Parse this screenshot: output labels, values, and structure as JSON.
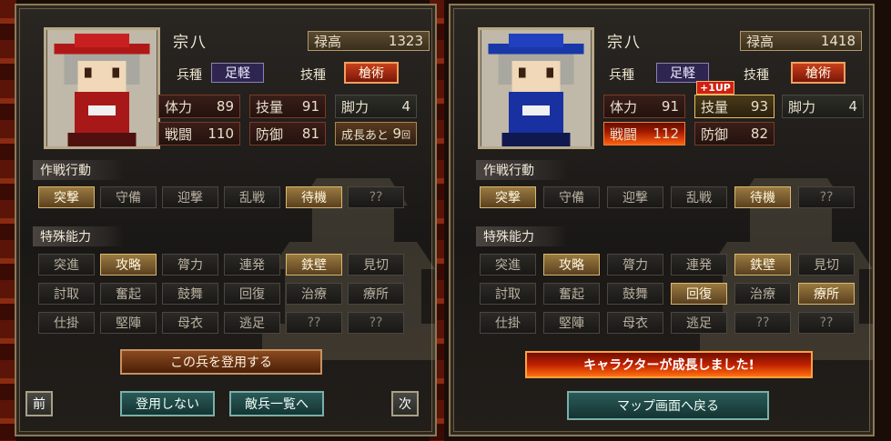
{
  "colors": {
    "accent": "#c8401a",
    "selected": "#9a7a40",
    "teal": "#2a5a58"
  },
  "left": {
    "name": "宗八",
    "rokudaka_label": "禄高",
    "rokudaka_value": "1323",
    "heishu_label": "兵種",
    "heishu_value": "足軽",
    "gijutsu_label": "技種",
    "gijutsu_value": "槍術",
    "stats": [
      {
        "label": "体力",
        "value": "89"
      },
      {
        "label": "技量",
        "value": "91"
      },
      {
        "label": "脚力",
        "value": "4"
      },
      {
        "label": "戦闘",
        "value": "110"
      },
      {
        "label": "防御",
        "value": "81"
      },
      {
        "label": "成長あと",
        "value": "9",
        "unit": "回"
      }
    ],
    "section1": "作戦行動",
    "actions": [
      "突撃",
      "守備",
      "迎撃",
      "乱戦",
      "待機",
      "??"
    ],
    "actions_on": [
      true,
      false,
      false,
      false,
      true,
      false
    ],
    "section2": "特殊能力",
    "abilities": [
      "突進",
      "攻略",
      "膂力",
      "連発",
      "鉄壁",
      "見切",
      "討取",
      "奮起",
      "鼓舞",
      "回復",
      "治療",
      "療所",
      "仕掛",
      "堅陣",
      "母衣",
      "逃足",
      "??",
      "??"
    ],
    "abilities_on": [
      false,
      true,
      false,
      false,
      true,
      false,
      false,
      false,
      false,
      false,
      false,
      false,
      false,
      false,
      false,
      false,
      false,
      false
    ],
    "btn_recruit": "この兵を登用する",
    "btn_prev": "前",
    "btn_decline": "登用しない",
    "btn_enemy_list": "敵兵一覧へ",
    "btn_next": "次"
  },
  "right": {
    "name": "宗八",
    "rokudaka_label": "禄高",
    "rokudaka_value": "1418",
    "heishu_label": "兵種",
    "heishu_value": "足軽",
    "gijutsu_label": "技種",
    "gijutsu_value": "槍術",
    "stats": [
      {
        "label": "体力",
        "value": "91"
      },
      {
        "label": "技量",
        "value": "93"
      },
      {
        "label": "脚力",
        "value": "4"
      },
      {
        "label": "戦闘",
        "value": "112"
      },
      {
        "label": "防御",
        "value": "82"
      }
    ],
    "up_badge": "+1UP",
    "section1": "作戦行動",
    "actions": [
      "突撃",
      "守備",
      "迎撃",
      "乱戦",
      "待機",
      "??"
    ],
    "actions_on": [
      true,
      false,
      false,
      false,
      true,
      false
    ],
    "section2": "特殊能力",
    "abilities": [
      "突進",
      "攻略",
      "膂力",
      "連発",
      "鉄壁",
      "見切",
      "討取",
      "奮起",
      "鼓舞",
      "回復",
      "治療",
      "療所",
      "仕掛",
      "堅陣",
      "母衣",
      "逃足",
      "??",
      "??"
    ],
    "abilities_on": [
      false,
      true,
      false,
      false,
      true,
      false,
      false,
      false,
      false,
      true,
      false,
      true,
      false,
      false,
      false,
      false,
      false,
      false
    ],
    "btn_grown": "キャラクターが成長しました!",
    "btn_map": "マップ画面へ戻る"
  }
}
